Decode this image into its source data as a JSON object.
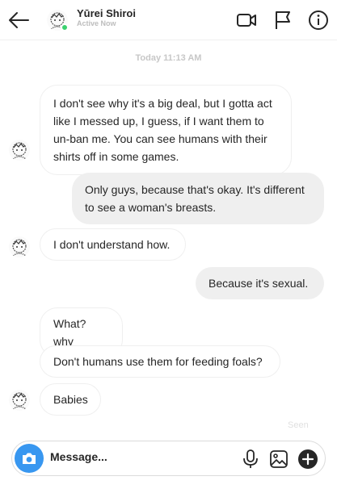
{
  "header": {
    "contact_name": "Yūrei Shiroi",
    "status": "Active Now",
    "icons": [
      "back-arrow-icon",
      "video-call-icon",
      "report-flag-icon",
      "info-icon"
    ]
  },
  "timestamp": "Today 11:13 AM",
  "messages": [
    {
      "from": "them",
      "text": "I don't see why it's a big deal, but I gotta act like I messed up, I guess, if I want them to un-ban me. You can see humans with their shirts off in some games."
    },
    {
      "from": "me",
      "text": "Only guys, because that's okay. It's different to see a woman's breasts."
    },
    {
      "from": "them",
      "text": "I don't understand how."
    },
    {
      "from": "me",
      "text": "Because it's sexual."
    },
    {
      "from": "them",
      "text": "What? why"
    },
    {
      "from": "them",
      "text": "Don't humans use them for feeding foals?"
    },
    {
      "from": "them",
      "text": "Babies"
    }
  ],
  "seen_label": "Seen",
  "composer": {
    "placeholder": "Message...",
    "icons": [
      "camera-icon",
      "microphone-icon",
      "gallery-icon",
      "plus-icon"
    ]
  },
  "colors": {
    "accent": "#3897f0",
    "online": "#3bd16f",
    "outgoing_bubble": "#efefef"
  }
}
